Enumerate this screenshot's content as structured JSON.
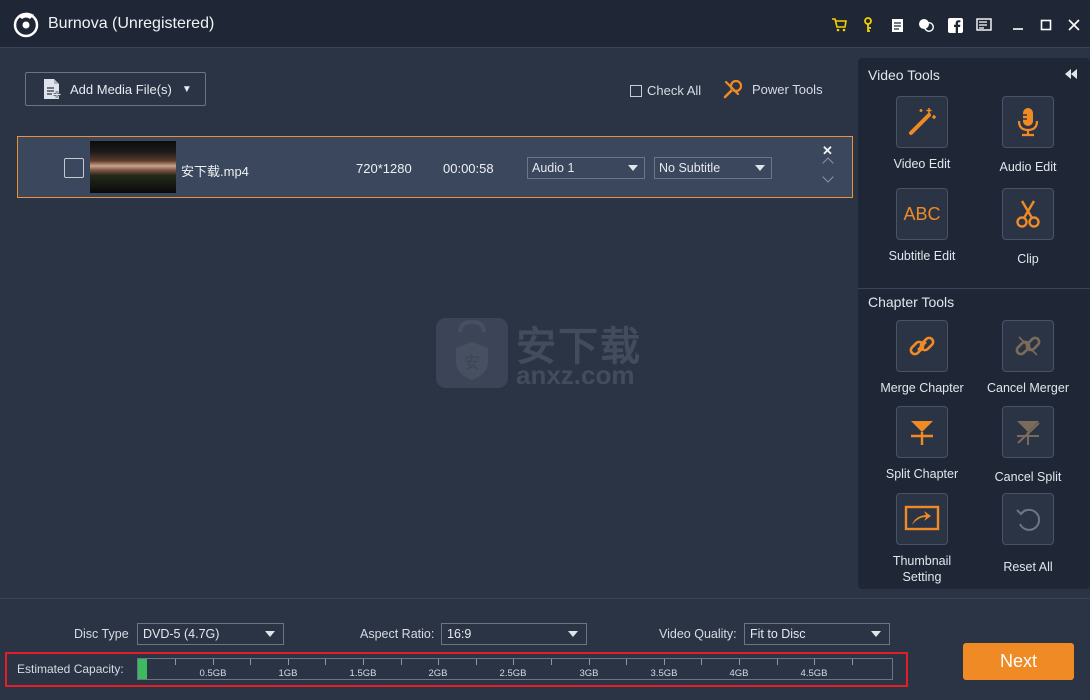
{
  "window": {
    "title": "Burnova (Unregistered)"
  },
  "toolbar": {
    "add_media_label": "Add Media File(s)",
    "check_all_label": "Check All",
    "power_tools_label": "Power Tools"
  },
  "file": {
    "name": "安下载.mp4",
    "resolution": "720*1280",
    "duration": "00:00:58",
    "audio": "Audio 1",
    "subtitle": "No Subtitle"
  },
  "watermark": {
    "main": "安下载",
    "sub": "anxz.com",
    "badge": "安"
  },
  "video_tools": {
    "title": "Video Tools",
    "items": [
      {
        "label": "Video Edit",
        "icon": "magic-wand-icon"
      },
      {
        "label": "Audio Edit",
        "icon": "microphone-icon"
      },
      {
        "label": "Subtitle Edit",
        "icon": "abc-icon",
        "glyph": "ABC"
      },
      {
        "label": "Clip",
        "icon": "scissors-icon"
      }
    ]
  },
  "chapter_tools": {
    "title": "Chapter Tools",
    "items": [
      {
        "label": "Merge Chapter",
        "icon": "link-icon"
      },
      {
        "label": "Cancel Merger",
        "icon": "broken-link-icon"
      },
      {
        "label": "Split Chapter",
        "icon": "split-icon"
      },
      {
        "label": "Cancel Split",
        "icon": "cancel-split-icon"
      },
      {
        "label": "Thumbnail Setting",
        "line1": "Thumbnail",
        "line2": "Setting",
        "icon": "thumbnail-icon"
      },
      {
        "label": "Reset All",
        "icon": "reset-icon"
      }
    ]
  },
  "settings": {
    "disc_type_label": "Disc Type",
    "disc_type_value": "DVD-5 (4.7G)",
    "aspect_ratio_label": "Aspect Ratio:",
    "aspect_ratio_value": "16:9",
    "video_quality_label": "Video Quality:",
    "video_quality_value": "Fit to Disc"
  },
  "capacity": {
    "label": "Estimated Capacity:",
    "used_fraction": 0.012,
    "ticks": [
      "0.5GB",
      "1GB",
      "1.5GB",
      "2GB",
      "2.5GB",
      "3GB",
      "3.5GB",
      "4GB",
      "4.5GB"
    ]
  },
  "next_label": "Next",
  "colors": {
    "accent": "#f08a24",
    "highlight_border": "#e31e24",
    "capacity_fill": "#3cba5f",
    "panel_bg": "#1f2737",
    "main_bg": "#2b3445"
  }
}
